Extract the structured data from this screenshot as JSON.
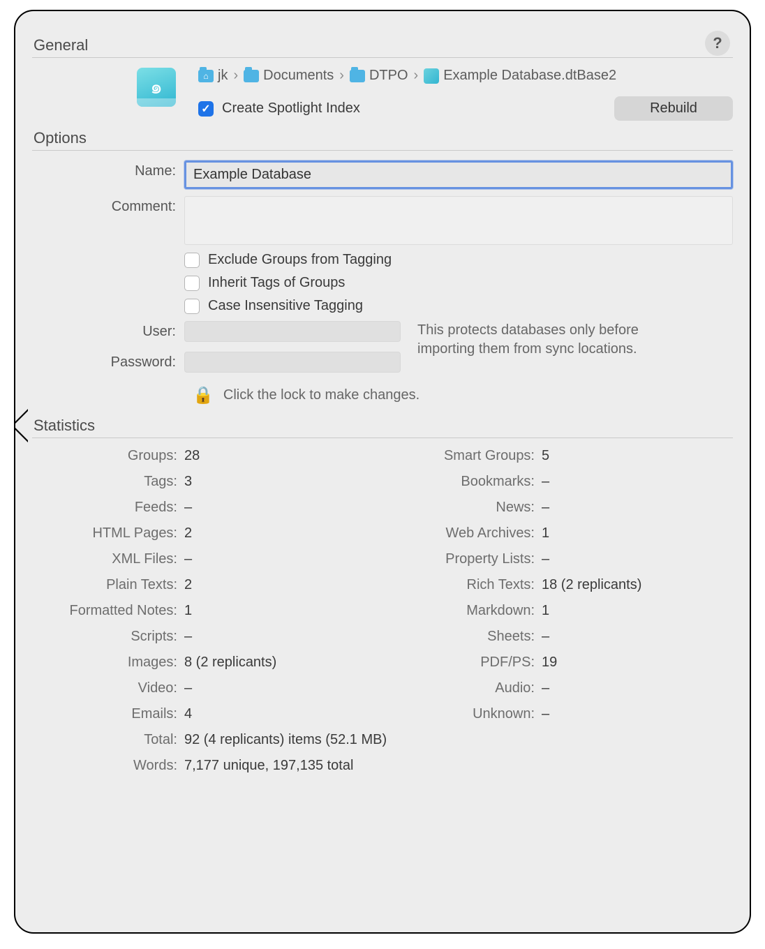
{
  "help_icon": "?",
  "sections": {
    "general": "General",
    "options": "Options",
    "statistics": "Statistics"
  },
  "breadcrumb": [
    "jk",
    "Documents",
    "DTPO",
    "Example Database.dtBase2"
  ],
  "spotlight": {
    "label": "Create Spotlight Index",
    "checked": true
  },
  "rebuild_label": "Rebuild",
  "fields": {
    "name_label": "Name:",
    "name_value": "Example Database",
    "comment_label": "Comment:",
    "comment_value": "",
    "checkboxes": [
      {
        "label": "Exclude Groups from Tagging",
        "checked": false
      },
      {
        "label": "Inherit Tags of Groups",
        "checked": false
      },
      {
        "label": "Case Insensitive Tagging",
        "checked": false
      }
    ],
    "user_label": "User:",
    "user_value": "",
    "password_label": "Password:",
    "password_value": "",
    "protection_note": "This protects databases only before importing them from sync locations.",
    "lock_text": "Click the lock to make changes."
  },
  "stats_left": [
    {
      "label": "Groups:",
      "value": "28"
    },
    {
      "label": "Tags:",
      "value": "3"
    },
    {
      "label": "Feeds:",
      "value": "–"
    },
    {
      "label": "HTML Pages:",
      "value": "2"
    },
    {
      "label": "XML Files:",
      "value": "–"
    },
    {
      "label": "Plain Texts:",
      "value": "2"
    },
    {
      "label": "Formatted Notes:",
      "value": "1"
    },
    {
      "label": "Scripts:",
      "value": "–"
    },
    {
      "label": "Images:",
      "value": "8 (2 replicants)"
    },
    {
      "label": "Video:",
      "value": "–"
    },
    {
      "label": "Emails:",
      "value": "4"
    }
  ],
  "stats_right": [
    {
      "label": "Smart Groups:",
      "value": "5"
    },
    {
      "label": "Bookmarks:",
      "value": "–"
    },
    {
      "label": "News:",
      "value": "–"
    },
    {
      "label": "Web Archives:",
      "value": "1"
    },
    {
      "label": "Property Lists:",
      "value": "–"
    },
    {
      "label": "Rich Texts:",
      "value": "18 (2 replicants)"
    },
    {
      "label": "Markdown:",
      "value": "1"
    },
    {
      "label": "Sheets:",
      "value": "–"
    },
    {
      "label": "PDF/PS:",
      "value": "19"
    },
    {
      "label": "Audio:",
      "value": "–"
    },
    {
      "label": "Unknown:",
      "value": "–"
    }
  ],
  "stats_totals": [
    {
      "label": "Total:",
      "value": "92 (4 replicants) items (52.1 MB)"
    },
    {
      "label": "Words:",
      "value": "7,177 unique, 197,135 total"
    }
  ]
}
